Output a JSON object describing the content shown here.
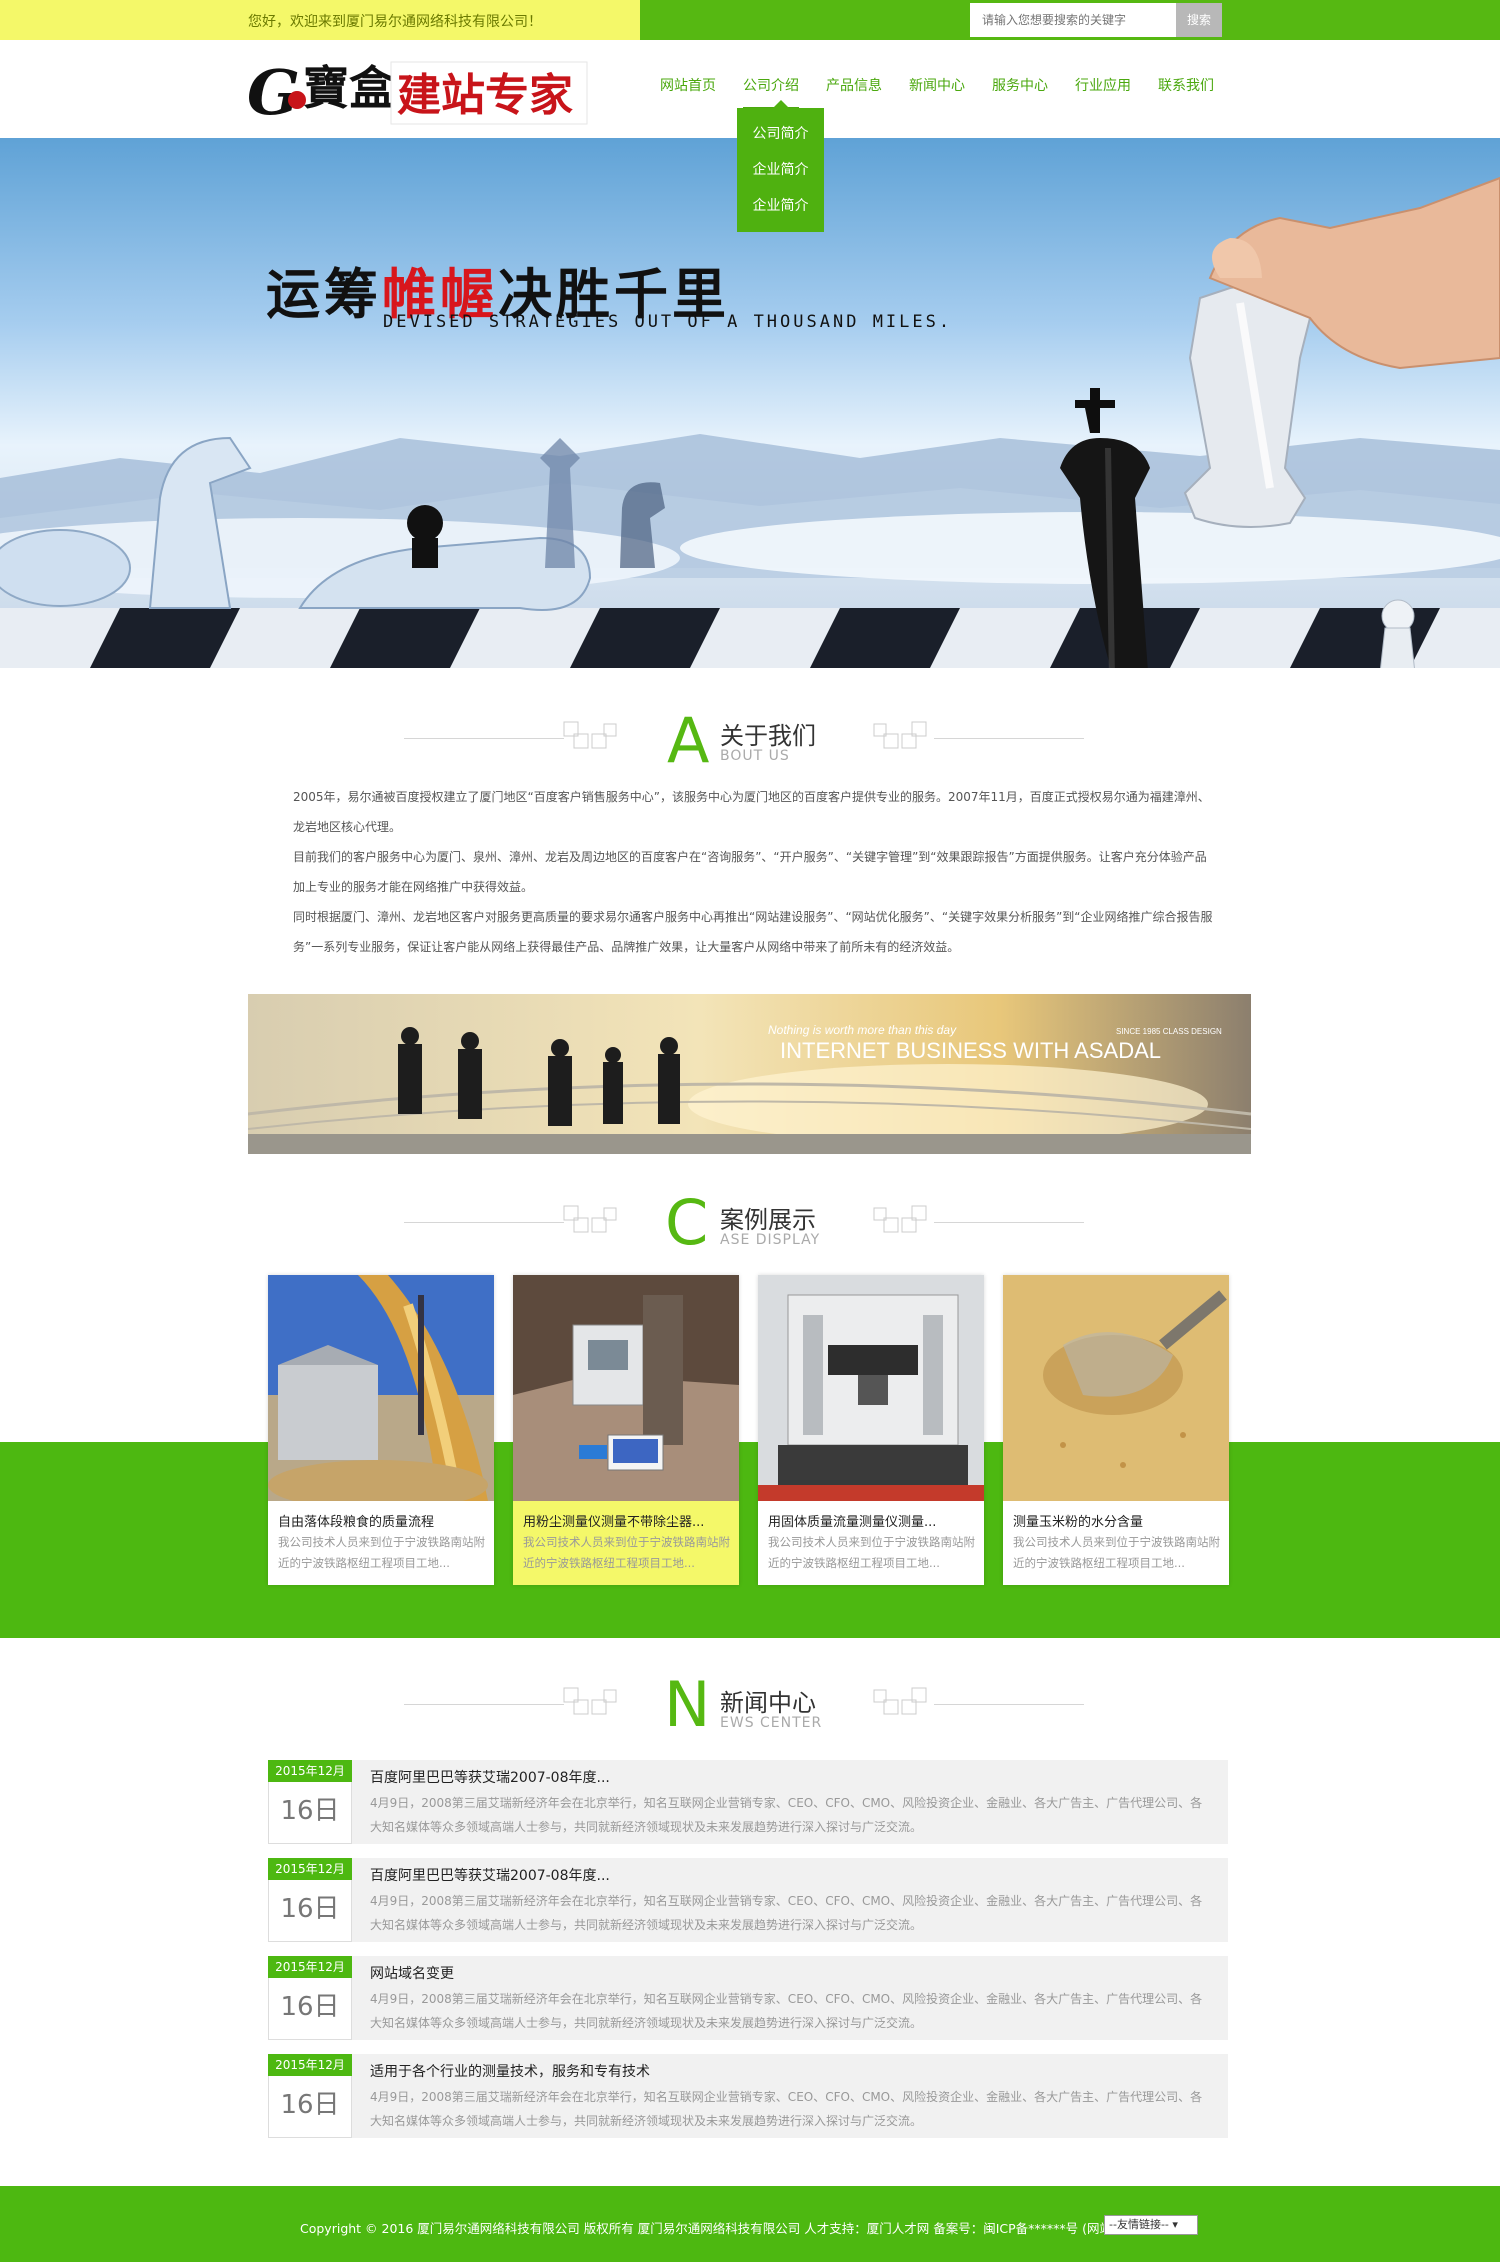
{
  "topbar": {
    "welcome": "您好，欢迎来到厦门易尔通网络科技有限公司！",
    "search_placeholder": "请输入您想要搜索的关键字",
    "search_button": "搜索"
  },
  "nav": {
    "items": [
      "网站首页",
      "公司介绍",
      "产品信息",
      "新闻中心",
      "服务中心",
      "行业应用",
      "联系我们"
    ],
    "active_index": 1,
    "dropdown": [
      "公司简介",
      "企业简介",
      "企业简介"
    ]
  },
  "hero": {
    "title_pre": "运筹",
    "title_red": "帷幄",
    "title_post": "决胜千里",
    "subtitle": "DEVISED STRATEGIES OUT OF A THOUSAND MILES."
  },
  "about": {
    "letter": "A",
    "title": "关于我们",
    "en": "BOUT US",
    "paragraphs": [
      "2005年，易尔通被百度授权建立了厦门地区“百度客户销售服务中心”，该服务中心为厦门地区的百度客户提供专业的服务。2007年11月，百度正式授权易尔通为福建漳州、龙岩地区核心代理。",
      "目前我们的客户服务中心为厦门、泉州、漳州、龙岩及周边地区的百度客户在“咨询服务”、“开户服务”、“关键字管理”到“效果跟踪报告”方面提供服务。让客户充分体验产品加上专业的服务才能在网络推广中获得效益。",
      "同时根据厦门、漳州、龙岩地区客户对服务更高质量的要求易尔通客户服务中心再推出“网站建设服务”、“网站优化服务”、“关键字效果分析服务”到“企业网络推广综合报告服务”一系列专业服务，保证让客户能从网络上获得最佳产品、品牌推广效果，让大量客户从网络中带来了前所未有的经济效益。"
    ]
  },
  "banner2": {
    "line1": "Nothing is worth more than this day",
    "line2": "INTERNET BUSINESS WITH ASADAL",
    "corner": "SINCE 1985 CLASS DESIGN"
  },
  "cases": {
    "letter": "C",
    "title": "案例展示",
    "en": "ASE DISPLAY",
    "items": [
      {
        "title": "自由落体段粮食的质量流程",
        "desc": "我公司技术人员来到位于宁波铁路南站附近的宁波铁路枢纽工程项目工地..."
      },
      {
        "title": "用粉尘测量仪测量不带除尘器...",
        "desc": "我公司技术人员来到位于宁波铁路南站附近的宁波铁路枢纽工程项目工地..."
      },
      {
        "title": "用固体质量流量测量仪测量...",
        "desc": "我公司技术人员来到位于宁波铁路南站附近的宁波铁路枢纽工程项目工地..."
      },
      {
        "title": "测量玉米粉的水分含量",
        "desc": "我公司技术人员来到位于宁波铁路南站附近的宁波铁路枢纽工程项目工地..."
      }
    ]
  },
  "news": {
    "letter": "N",
    "title": "新闻中心",
    "en": "EWS CENTER",
    "items": [
      {
        "ym": "2015年12月",
        "day": "16日",
        "title": "百度阿里巴巴等获艾瑞2007-08年度...",
        "desc": "4月9日，2008第三届艾瑞新经济年会在北京举行，知名互联网企业营销专家、CEO、CFO、CMO、风险投资企业、金融业、各大广告主、广告代理公司、各大知名媒体等众多领域高端人士参与，共同就新经济领域现状及未来发展趋势进行深入探讨与广泛交流。"
      },
      {
        "ym": "2015年12月",
        "day": "16日",
        "title": "百度阿里巴巴等获艾瑞2007-08年度...",
        "desc": "4月9日，2008第三届艾瑞新经济年会在北京举行，知名互联网企业营销专家、CEO、CFO、CMO、风险投资企业、金融业、各大广告主、广告代理公司、各大知名媒体等众多领域高端人士参与，共同就新经济领域现状及未来发展趋势进行深入探讨与广泛交流。"
      },
      {
        "ym": "2015年12月",
        "day": "16日",
        "title": "网站域名变更",
        "desc": "4月9日，2008第三届艾瑞新经济年会在北京举行，知名互联网企业营销专家、CEO、CFO、CMO、风险投资企业、金融业、各大广告主、广告代理公司、各大知名媒体等众多领域高端人士参与，共同就新经济领域现状及未来发展趋势进行深入探讨与广泛交流。"
      },
      {
        "ym": "2015年12月",
        "day": "16日",
        "title": "适用于各个行业的测量技术，服务和专有技术",
        "desc": "4月9日，2008第三届艾瑞新经济年会在北京举行，知名互联网企业营销专家、CEO、CFO、CMO、风险投资企业、金融业、各大广告主、广告代理公司、各大知名媒体等众多领域高端人士参与，共同就新经济领域现状及未来发展趋势进行深入探讨与广泛交流。"
      }
    ]
  },
  "footer": {
    "text": "Copyright © 2016 厦门易尔通网络科技有限公司 版权所有 厦门易尔通网络科技有限公司 人才支持：厦门人才网 备案号：闽ICP备******号 (网站地图)",
    "select": "--友情链接-- ▾"
  },
  "logo": {
    "mark": "G",
    "brand": "寶盒",
    "slogan": "建站专家"
  },
  "colors": {
    "green": "#4db811",
    "yellow": "#f4f869",
    "red": "#d8161c"
  }
}
